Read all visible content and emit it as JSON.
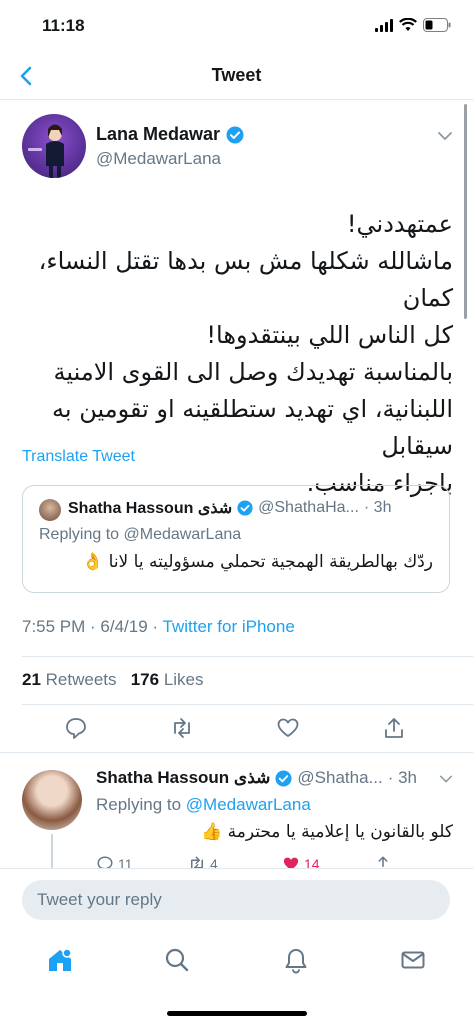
{
  "status_bar": {
    "time": "11:18"
  },
  "nav": {
    "title": "Tweet"
  },
  "tweet": {
    "author_name": "Lana Medawar",
    "author_handle": "@MedawarLana",
    "text_lines": [
      "عمتهددني!",
      "ماشالله شكلها مش بس بدها تقتل النساء، كمان",
      "كل الناس اللي بينتقدوها!",
      "بالمناسبة تهديدك وصل الى القوى الامنية",
      "اللبنانية، اي تهديد ستطلقينه او تقومين به سيقابل",
      "باجراء مناسب."
    ],
    "translate_label": "Translate Tweet",
    "quote": {
      "name": "Shatha Hassoun شذى",
      "handle": "@ShathaHa...",
      "time": "· 3h",
      "replying_to": "Replying to @MedawarLana",
      "text": "ردّك بهالطريقة الهمجية تحملي مسؤوليته يا لانا 👌"
    },
    "time": "7:55 PM · 6/4/19 ·",
    "source": "Twitter for iPhone",
    "retweets_count": "21",
    "retweets_label": "Retweets",
    "likes_count": "176",
    "likes_label": "Likes"
  },
  "reply": {
    "name": "Shatha Hassoun شذى",
    "handle": "@Shatha...",
    "time": "· 3h",
    "replying_prefix": "Replying to",
    "replying_mention": "@MedawarLana",
    "text": "كلو بالقانون يا إعلامية يا محترمة 👍",
    "reply_count": "11",
    "retweet_count": "4",
    "like_count": "14"
  },
  "composer": {
    "placeholder": "Tweet your reply"
  },
  "colors": {
    "accent": "#1da1f2",
    "like": "#e0245e",
    "text": "#14171a",
    "secondary": "#657786"
  },
  "icons": [
    "back-chevron-icon",
    "verified-badge-icon",
    "chevron-down-icon",
    "reply-icon",
    "retweet-icon",
    "like-icon",
    "share-icon",
    "home-icon",
    "search-icon",
    "notifications-icon",
    "messages-icon"
  ]
}
